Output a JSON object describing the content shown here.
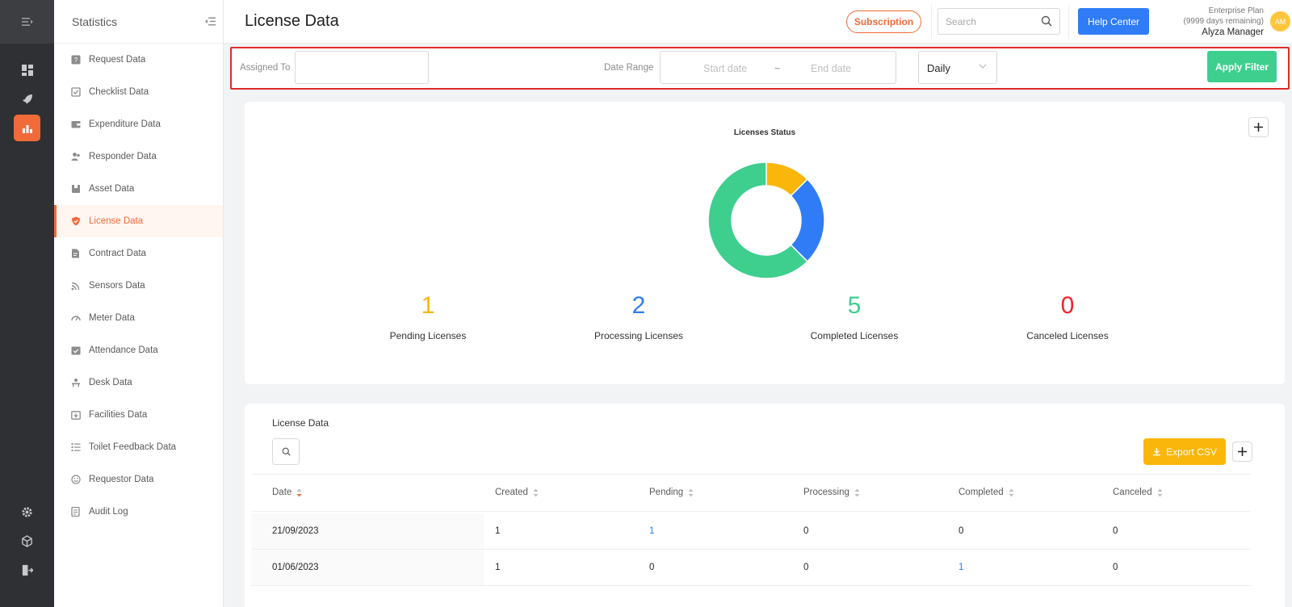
{
  "sidebar": {
    "title": "Statistics",
    "items": [
      {
        "label": "Request Data",
        "icon": "question-square-icon",
        "active": false
      },
      {
        "label": "Checklist Data",
        "icon": "checklist-icon",
        "active": false
      },
      {
        "label": "Expenditure Data",
        "icon": "wallet-icon",
        "active": false
      },
      {
        "label": "Responder Data",
        "icon": "user-group-icon",
        "active": false
      },
      {
        "label": "Asset Data",
        "icon": "box-icon",
        "active": false
      },
      {
        "label": "License Data",
        "icon": "shield-icon",
        "active": true
      },
      {
        "label": "Contract Data",
        "icon": "document-edit-icon",
        "active": false
      },
      {
        "label": "Sensors Data",
        "icon": "signal-icon",
        "active": false
      },
      {
        "label": "Meter Data",
        "icon": "gauge-icon",
        "active": false
      },
      {
        "label": "Attendance Data",
        "icon": "calendar-check-icon",
        "active": false
      },
      {
        "label": "Desk Data",
        "icon": "desk-icon",
        "active": false
      },
      {
        "label": "Facilities Data",
        "icon": "calendar-plus-icon",
        "active": false
      },
      {
        "label": "Toilet Feedback Data",
        "icon": "list-icon",
        "active": false
      },
      {
        "label": "Requestor Data",
        "icon": "smile-icon",
        "active": false
      },
      {
        "label": "Audit Log",
        "icon": "audit-icon",
        "active": false
      }
    ]
  },
  "header": {
    "title": "License Data",
    "subscription_label": "Subscription",
    "search_placeholder": "Search",
    "help_label": "Help Center",
    "plan_name": "Enterprise Plan",
    "plan_days": "(9999 days remaining)",
    "user_name": "Alyza Manager",
    "avatar_initials": "AM"
  },
  "filter": {
    "assigned_label": "Assigned To",
    "assigned_value": "",
    "date_range_label": "Date Range",
    "start_placeholder": "Start date",
    "separator": "~",
    "end_placeholder": "End date",
    "interval_value": "Daily",
    "apply_label": "Apply Filter"
  },
  "status": {
    "chart_title": "Licenses Status",
    "stats": [
      {
        "value": "1",
        "label": "Pending Licenses",
        "color": "#fab60a"
      },
      {
        "value": "2",
        "label": "Processing Licenses",
        "color": "#2f7cf6"
      },
      {
        "value": "5",
        "label": "Completed Licenses",
        "color": "#3ecf8e"
      },
      {
        "value": "0",
        "label": "Canceled Licenses",
        "color": "#f5222d"
      }
    ]
  },
  "chart_data": {
    "type": "pie",
    "title": "Licenses Status",
    "categories": [
      "Pending",
      "Processing",
      "Completed",
      "Canceled"
    ],
    "values": [
      1,
      2,
      5,
      0
    ],
    "colors": [
      "#fab60a",
      "#2f7cf6",
      "#3ecf8e",
      "#f5222d"
    ],
    "donut": true
  },
  "table": {
    "title": "License Data",
    "export_label": "Export CSV",
    "columns": [
      "Date",
      "Created",
      "Pending",
      "Processing",
      "Completed",
      "Canceled"
    ],
    "rows": [
      {
        "date": "21/09/2023",
        "created": "1",
        "pending": "1",
        "processing": "0",
        "completed": "0",
        "canceled": "0"
      },
      {
        "date": "01/06/2023",
        "created": "1",
        "pending": "0",
        "processing": "0",
        "completed": "1",
        "canceled": "0"
      }
    ]
  }
}
